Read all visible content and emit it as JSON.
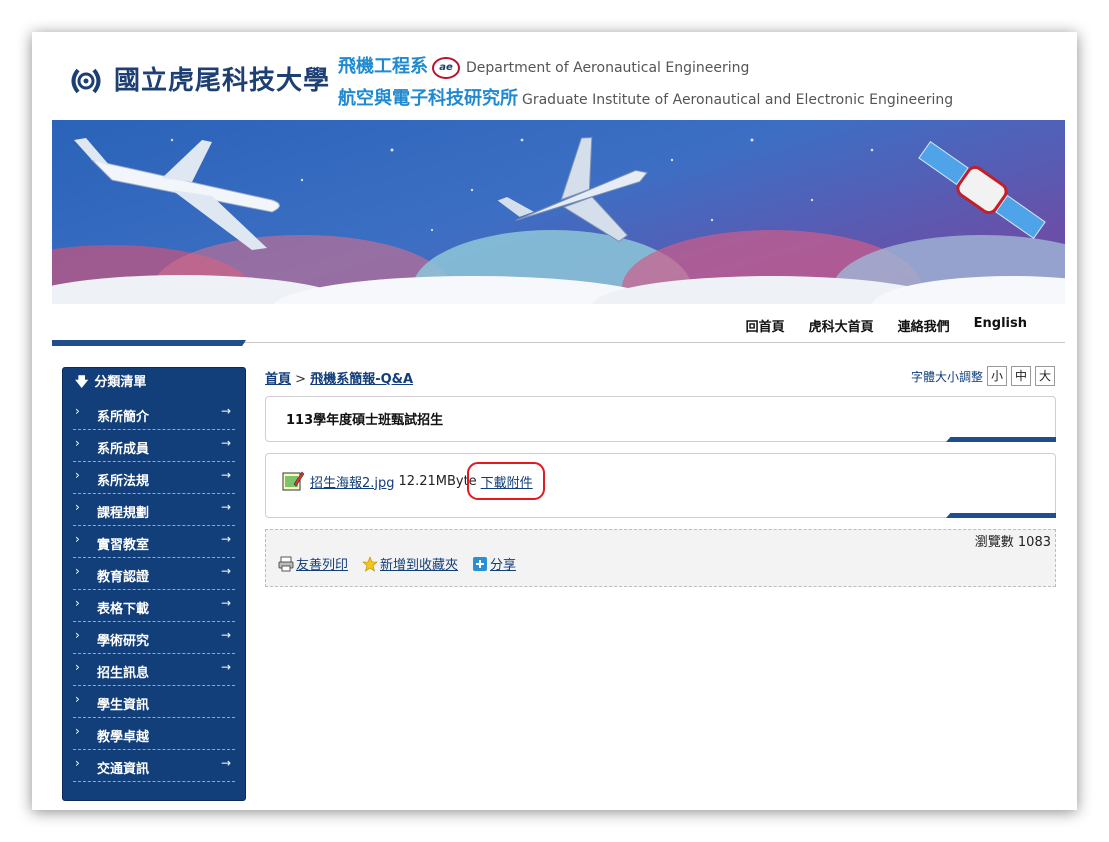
{
  "header": {
    "university_name": "國立虎尾科技大學",
    "dept_zh": "飛機工程系",
    "dept_badge": "ae",
    "dept_en": "Department of Aeronautical Engineering",
    "institute_zh": "航空與電子科技研究所",
    "institute_en": "Graduate Institute of Aeronautical and Electronic Engineering"
  },
  "topnav": [
    "回首頁",
    "虎科大首頁",
    "連絡我們",
    "English"
  ],
  "sidebar": {
    "title": "分類清單",
    "items": [
      "系所簡介",
      "系所成員",
      "系所法規",
      "課程規劃",
      "實習教室",
      "教育認證",
      "表格下載",
      "學術研究",
      "招生訊息",
      "學生資訊",
      "教學卓越",
      "交通資訊"
    ]
  },
  "breadcrumb": {
    "home": "首頁",
    "sep": ">",
    "current": "飛機系簡報-Q&A"
  },
  "font_size": {
    "label": "字體大小調整",
    "options": [
      "小",
      "中",
      "大"
    ]
  },
  "article": {
    "title": "113學年度碩士班甄試招生"
  },
  "attachment": {
    "filename": "招生海報2.jpg",
    "size": "12.21MByte",
    "download_label": "下載附件"
  },
  "stats": {
    "views": "瀏覽數 1083"
  },
  "tools": {
    "print": "友善列印",
    "favorite": "新增到收藏夾",
    "share": "分享"
  },
  "colors": {
    "navy": "#123e7a",
    "accent_blue": "#1f8ad1",
    "highlight_red": "#e2191f"
  }
}
